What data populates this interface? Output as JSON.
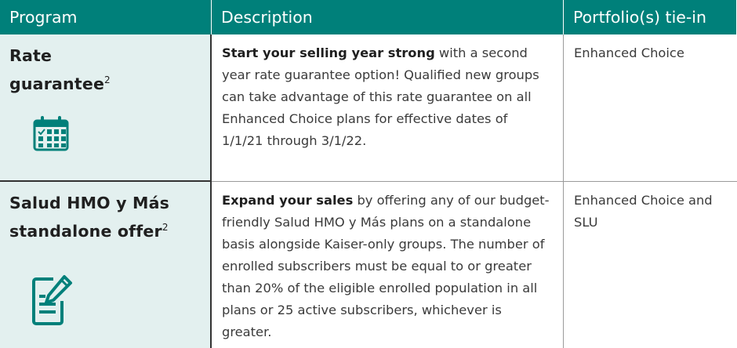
{
  "headers": {
    "program": "Program",
    "description": "Description",
    "portfolio": "Portfolio(s) tie-in"
  },
  "rows": [
    {
      "program_line1": "Rate",
      "program_line2": "guarantee",
      "program_sup": "2",
      "icon": "calendar-icon",
      "description_lead": "Start your selling year strong",
      "description_rest": " with a second year rate guarantee option! Qualified new groups can take advantage of this rate guarantee on all Enhanced Choice plans for effective dates of 1/1/21 through 3/1/22.",
      "portfolio": "Enhanced Choice"
    },
    {
      "program_line1": "Salud HMO y Más",
      "program_line2": "standalone offer",
      "program_sup": "2",
      "icon": "form-edit-icon",
      "description_lead": "Expand your sales",
      "description_rest": " by offering any of our budget-friendly Salud HMO y Más plans on a standalone basis alongside Kaiser-only groups. The number of enrolled subscribers must be equal to or greater than 20% of the eligible enrolled population in all plans or 25 active subscribers, whichever is greater.",
      "portfolio": "Enhanced Choice and SLU"
    }
  ],
  "colors": {
    "header_bg": "#00807a",
    "program_cell_bg": "#e3f0ef",
    "icon_color": "#00807a"
  }
}
